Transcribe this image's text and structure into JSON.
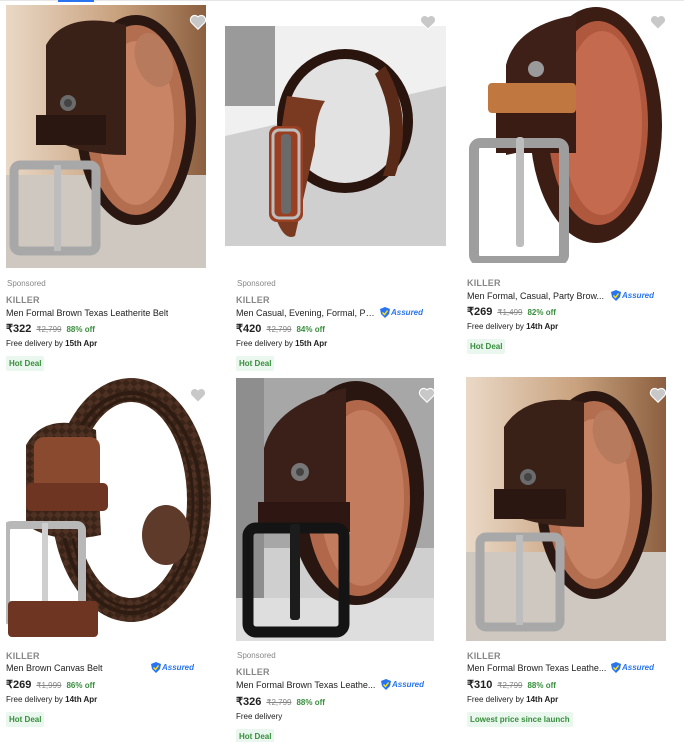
{
  "products": [
    {
      "sponsored": "Sponsored",
      "brand": "KILLER",
      "title": "Men Formal Brown Texas Leatherite Belt",
      "assured": "",
      "price": "₹322",
      "mrp": "₹2,799",
      "discount": "88% off",
      "delivery_prefix": "Free delivery by ",
      "delivery_date": "15th Apr",
      "deal": "Hot Deal",
      "image_icon": "belt-brown-coiled-icon"
    },
    {
      "sponsored": "Sponsored",
      "brand": "KILLER",
      "title": "Men Casual, Evening, Formal, Pa...",
      "assured": "Assured",
      "price": "₹420",
      "mrp": "₹2,799",
      "discount": "84% off",
      "delivery_prefix": "Free delivery by ",
      "delivery_date": "15th Apr",
      "deal": "Hot Deal",
      "image_icon": "belt-brown-slim-buckle-icon"
    },
    {
      "sponsored": "",
      "brand": "KILLER",
      "title": "Men Formal, Casual, Party Brow...",
      "assured": "Assured",
      "price": "₹269",
      "mrp": "₹1,499",
      "discount": "82% off",
      "delivery_prefix": "Free delivery by ",
      "delivery_date": "14th Apr",
      "deal": "Hot Deal",
      "image_icon": "belt-dark-brown-tan-loop-icon"
    },
    {
      "sponsored": "",
      "brand": "KILLER",
      "title": "Men Brown Canvas Belt",
      "assured": "Assured",
      "price": "₹269",
      "mrp": "₹1,999",
      "discount": "86% off",
      "delivery_prefix": "Free delivery by ",
      "delivery_date": "14th Apr",
      "deal": "Hot Deal",
      "image_icon": "belt-braided-canvas-icon"
    },
    {
      "sponsored": "Sponsored",
      "brand": "KILLER",
      "title": "Men Formal Brown Texas Leathe...",
      "assured": "Assured",
      "price": "₹326",
      "mrp": "₹2,799",
      "discount": "88% off",
      "delivery_prefix": "Free delivery",
      "delivery_date": "",
      "deal": "Hot Deal",
      "image_icon": "belt-brown-black-buckle-icon"
    },
    {
      "sponsored": "",
      "brand": "KILLER",
      "title": "Men Formal Brown Texas Leathe...",
      "assured": "Assured",
      "price": "₹310",
      "mrp": "₹2,799",
      "discount": "88% off",
      "delivery_prefix": "Free delivery by ",
      "delivery_date": "14th Apr",
      "deal": "Lowest price since launch",
      "image_icon": "belt-brown-coiled-icon"
    }
  ],
  "colors": {
    "accent": "#2874f0",
    "discount_green": "#388e3c",
    "deal_bg": "#e9f7ee",
    "muted": "#878787"
  }
}
